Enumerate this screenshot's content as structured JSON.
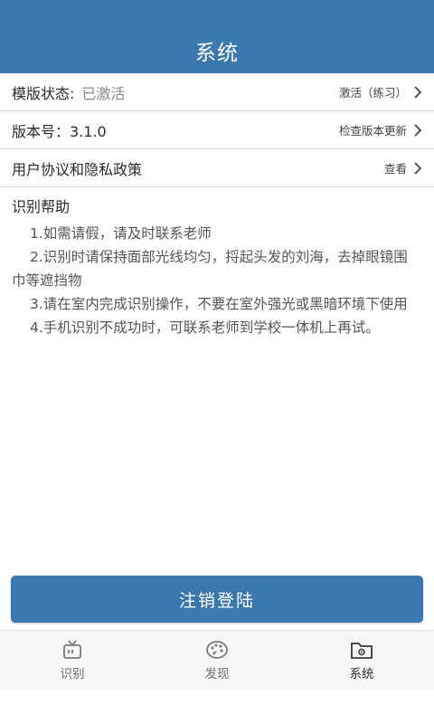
{
  "header": {
    "title": "系统"
  },
  "rows": {
    "template_status": {
      "label": "模版状态:",
      "value": "已激活",
      "action": "激活（练习）"
    },
    "version": {
      "label": "版本号：3.1.0",
      "action": "检查版本更新"
    },
    "agreement": {
      "label": "用户协议和隐私政策",
      "action": "查看"
    }
  },
  "help": {
    "title": "识别帮助",
    "items": [
      "1.如需请假，请及时联系老师",
      "2.识别时请保持面部光线均匀，捋起头发的刘海，去掉眼镜围巾等遮挡物",
      "3.请在室内完成识别操作，不要在室外强光或黑暗环境下使用",
      "4.手机识别不成功时，可联系老师到学校一体机上再试。"
    ]
  },
  "logout_label": "注销登陆",
  "tabs": [
    {
      "label": "识别",
      "icon": "tv-icon"
    },
    {
      "label": "发现",
      "icon": "palette-icon"
    },
    {
      "label": "系统",
      "icon": "folder-gear-icon"
    }
  ],
  "colors": {
    "primary": "#3b78ae",
    "tab_bg": "#f7f7f7"
  }
}
